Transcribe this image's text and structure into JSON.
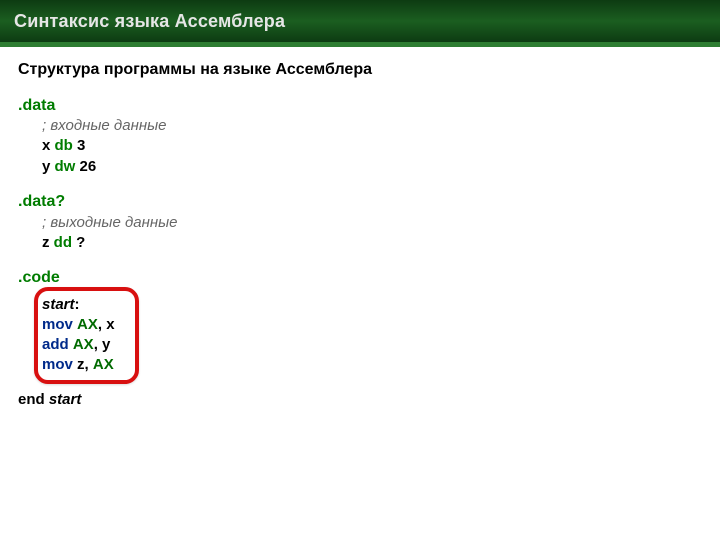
{
  "title": "Синтаксис языка Ассемблера",
  "subtitle": "Структура программы на языке Ассемблера",
  "sections": {
    "data": {
      "head": ".data",
      "comment": "; входные данные",
      "lines": [
        {
          "var": "x",
          "type": "db",
          "val": "3"
        },
        {
          "var": "y",
          "type": "dw",
          "val": "26"
        }
      ]
    },
    "dataq": {
      "head": ".data?",
      "comment": "; выходные данные",
      "lines": [
        {
          "var": "z",
          "type": "dd",
          "val": "?"
        }
      ]
    },
    "code": {
      "head": ".code",
      "start_label": "start",
      "lines": [
        {
          "op": "mov",
          "a": "AX",
          "b": "x"
        },
        {
          "op": "add",
          "a": "AX",
          "b": "y"
        },
        {
          "op": "mov",
          "a": "z",
          "b": "AX"
        }
      ]
    },
    "end": {
      "kw": "end",
      "label": "start"
    }
  }
}
